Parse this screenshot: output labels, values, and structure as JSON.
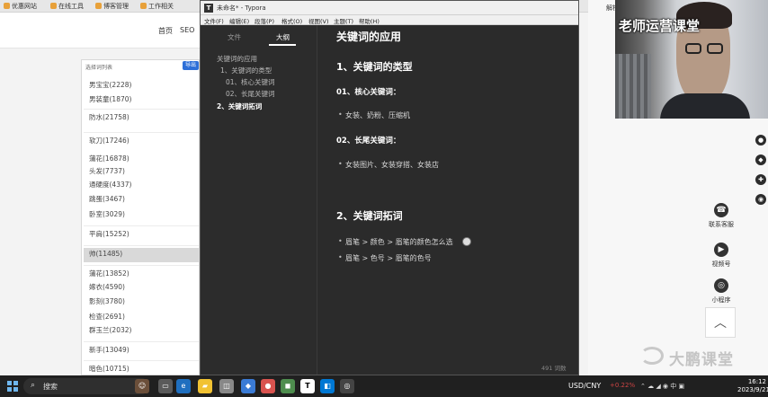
{
  "browser": {
    "bookmarks": [
      "优惠网站",
      "在线工具",
      "博客管理",
      "工作相关"
    ],
    "nav_links": [
      "首页",
      "SEO"
    ],
    "keyword_list": {
      "title": "选择词列表",
      "button": "导出",
      "items": [
        "男宝宝(2228)",
        "男装童(1870)",
        "防水(21758)",
        "软刀(17246)",
        "蒲花(16878)",
        "头发(7737)",
        "通硬度(4337)",
        "跳蛋(3467)",
        "卧室(3029)",
        "平肩(15252)",
        "帅(11485)",
        "蒲花(13852)",
        "嫁衣(4590)",
        "影刻(3780)",
        "检查(2691)",
        "群玉兰(2032)",
        "新手(13049)",
        "暗色(10715)"
      ]
    },
    "right_tab": "解析",
    "side_buttons": [
      {
        "label": "联系客服",
        "icon": "headset-icon"
      },
      {
        "label": "视频号",
        "icon": "video-icon"
      },
      {
        "label": "小程序",
        "icon": "miniprogram-icon"
      }
    ],
    "watermark": "大鹏课堂"
  },
  "webcam": {
    "title": "老师运营课堂"
  },
  "typora": {
    "window_title": "未命名* - Typora",
    "menu": [
      "文件(F)",
      "编辑(E)",
      "段落(P)",
      "格式(O)",
      "视图(V)",
      "主题(T)",
      "帮助(H)"
    ],
    "sidebar": {
      "tabs": [
        "文件",
        "大纲"
      ],
      "outline": [
        {
          "text": "关键词的应用",
          "level": 1
        },
        {
          "text": "1、关键词的类型",
          "level": 2
        },
        {
          "text": "01、核心关键词",
          "level": 3
        },
        {
          "text": "02、长尾关键词",
          "level": 3
        },
        {
          "text": "2、关键词拓词",
          "level": 2
        }
      ],
      "footer_left": "‹",
      "footer_right": "‹/›"
    },
    "document": {
      "h1": "关键词的应用",
      "section1": {
        "heading": "1、关键词的类型",
        "sub1": {
          "heading": "01、核心关键词：",
          "items": [
            "女装、奶粉、压缩机"
          ]
        },
        "sub2": {
          "heading": "02、长尾关键词：",
          "items": [
            "女装图片、女装穿搭、女装店"
          ]
        }
      },
      "section2": {
        "heading": "2、关键词拓词",
        "items": [
          "眉笔 > 颜色 > 眉笔的颜色怎么选",
          "眉笔 > 色号 > 眉笔的色号"
        ]
      },
      "word_count": "491 词数"
    }
  },
  "taskbar": {
    "search_placeholder": "搜索",
    "currency": "USD/CNY",
    "currency_change": "+0.22%",
    "time": "16:12",
    "date": "2023/9/21"
  }
}
